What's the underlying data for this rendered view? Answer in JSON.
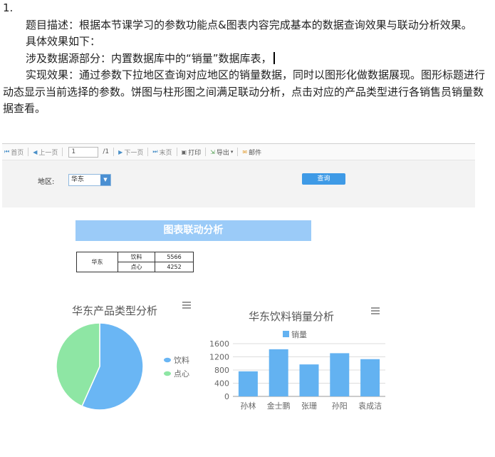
{
  "doc": {
    "number": "1.",
    "desc": "题目描述：根据本节课学习的参数功能点&图表内容完成基本的数据查询效果与联动分析效果。",
    "effect_intro": "具体效果如下：",
    "datasource": "涉及数据源部分：内置数据库中的“销量”数据库表，",
    "result": "实现效果：通过参数下拉地区查询对应地区的销量数据，同时以图形化做数据展现。图形标题进行动态显示当前选择的参数。饼图与柱形图之间满足联动分析，点击对应的产品类型进行各销售员销量数据查看。"
  },
  "toolbar": {
    "first": "首页",
    "prev": "上一页",
    "page": "1",
    "total": "/1",
    "next": "下一页",
    "last": "末页",
    "print": "打印",
    "export": "导出",
    "mail": "邮件"
  },
  "params": {
    "area_label": "地区:",
    "area_value": "华东",
    "query": "查询"
  },
  "report": {
    "title": "图表联动分析",
    "table": {
      "region": "华东",
      "rows": [
        {
          "type": "饮料",
          "value": "5566"
        },
        {
          "type": "点心",
          "value": "4252"
        }
      ]
    }
  },
  "chart_data": [
    {
      "type": "pie",
      "title": "华东产品类型分析",
      "labels": [
        "饮料",
        "点心"
      ],
      "values": [
        5566,
        4252
      ],
      "colors": [
        "#6ab6f4",
        "#8ee6a4"
      ],
      "legend": "right"
    },
    {
      "type": "bar",
      "title": "华东饮料销量分析",
      "categories": [
        "孙林",
        "金士鹏",
        "张珊",
        "孙阳",
        "袁成洁"
      ],
      "series": [
        {
          "name": "销量",
          "values": [
            760,
            1430,
            970,
            1310,
            1130
          ]
        }
      ],
      "ylim": [
        0,
        1600
      ],
      "yticks": [
        0,
        400,
        800,
        1200,
        1600
      ],
      "grid": true,
      "legend": "top",
      "color": "#63b2f1"
    }
  ]
}
